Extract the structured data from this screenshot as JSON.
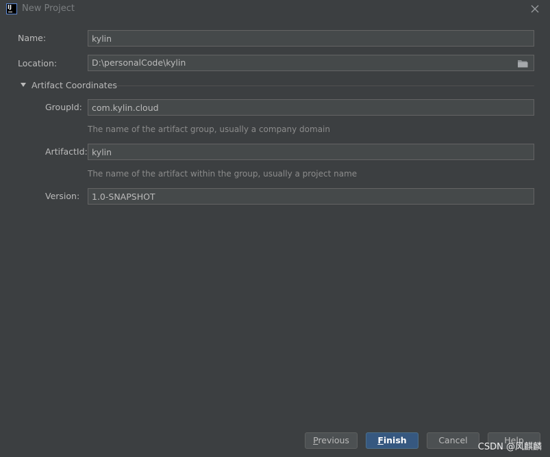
{
  "window": {
    "title": "New Project",
    "app_icon_text": "IJ"
  },
  "form": {
    "name": {
      "label": "Name:",
      "value": "kylin"
    },
    "location": {
      "label": "Location:",
      "value": "D:\\personalCode\\kylin"
    }
  },
  "artifact_coordinates": {
    "section_title": "Artifact Coordinates",
    "expanded": true,
    "group_id": {
      "label": "GroupId:",
      "value": "com.kylin.cloud",
      "hint": "The name of the artifact group, usually a company domain"
    },
    "artifact_id": {
      "label": "ArtifactId:",
      "value": "kylin",
      "hint": "The name of the artifact within the group, usually a project name"
    },
    "version": {
      "label": "Version:",
      "value": "1.0-SNAPSHOT"
    }
  },
  "buttons": {
    "previous": {
      "mnemonic": "P",
      "rest": "revious"
    },
    "finish": {
      "mnemonic": "F",
      "rest": "inish"
    },
    "cancel": {
      "label": "Cancel"
    },
    "help": {
      "label": "Help"
    }
  },
  "watermark": "CSDN @风麒麟",
  "colors": {
    "background": "#3c3f41",
    "field_background": "#45494a",
    "default_button": "#365880",
    "text": "#bbbbbb",
    "hint": "#8c8c8c"
  },
  "icons": {
    "app": "intellij-idea-icon",
    "close": "close-icon",
    "browse": "folder-icon",
    "expand": "triangle-down-icon"
  }
}
